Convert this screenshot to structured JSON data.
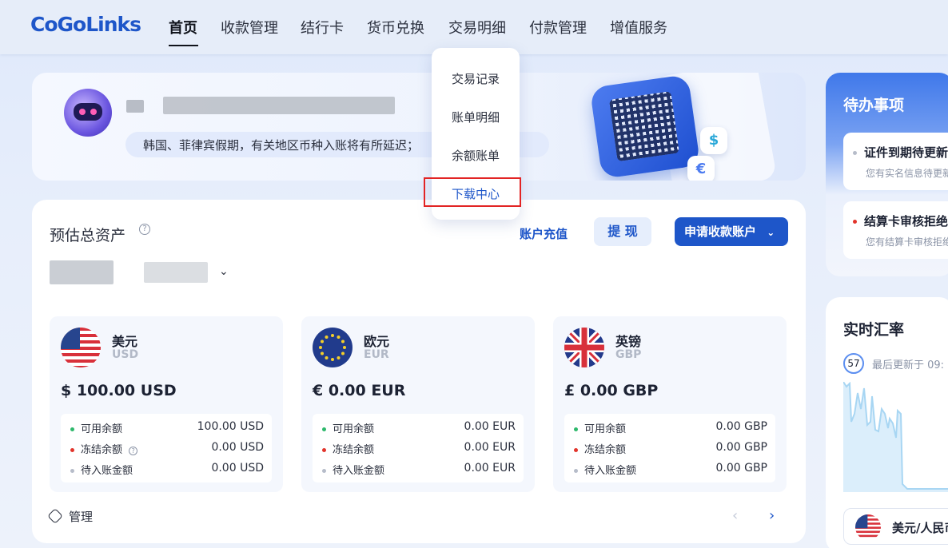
{
  "app": {
    "logo": "CoGoLinks"
  },
  "nav": {
    "items": [
      {
        "label": "首页",
        "active": true
      },
      {
        "label": "收款管理"
      },
      {
        "label": "结行卡"
      },
      {
        "label": "货币兑换"
      },
      {
        "label": "交易明细"
      },
      {
        "label": "付款管理"
      },
      {
        "label": "增值服务"
      }
    ]
  },
  "dropdown": {
    "items": [
      {
        "label": "交易记录"
      },
      {
        "label": "账单明细"
      },
      {
        "label": "余额账单"
      },
      {
        "label": "下载中心",
        "highlighted": true
      }
    ]
  },
  "banner": {
    "notice": "韩国、菲律宾假期，有关地区币种入账将有所延迟；"
  },
  "assets": {
    "title": "预估总资产",
    "help_icon": "question-circle-icon",
    "recharge_label": "账户充值",
    "withdraw_label": "提 现",
    "apply_label": "申请收款账户",
    "manage_label": "管理"
  },
  "currencies": [
    {
      "name": "美元",
      "code": "USD",
      "amount": "$ 100.00 USD",
      "flag": "us-flag-icon",
      "rows": [
        {
          "label": "可用余额",
          "value": "100.00 USD",
          "dot": "#2db86b"
        },
        {
          "label": "冻结余额",
          "value": "0.00 USD",
          "dot": "#e2342b",
          "help": true
        },
        {
          "label": "待入账金额",
          "value": "0.00 USD",
          "dot": "#b6bcc9"
        }
      ]
    },
    {
      "name": "欧元",
      "code": "EUR",
      "amount": "€ 0.00 EUR",
      "flag": "eu-flag-icon",
      "rows": [
        {
          "label": "可用余额",
          "value": "0.00 EUR",
          "dot": "#2db86b"
        },
        {
          "label": "冻结余额",
          "value": "0.00 EUR",
          "dot": "#e2342b"
        },
        {
          "label": "待入账金额",
          "value": "0.00 EUR",
          "dot": "#b6bcc9"
        }
      ]
    },
    {
      "name": "英镑",
      "code": "GBP",
      "amount": "£ 0.00 GBP",
      "flag": "uk-flag-icon",
      "rows": [
        {
          "label": "可用余额",
          "value": "0.00 GBP",
          "dot": "#2db86b"
        },
        {
          "label": "冻结余额",
          "value": "0.00 GBP",
          "dot": "#e2342b"
        },
        {
          "label": "待入账金额",
          "value": "0.00 GBP",
          "dot": "#b6bcc9"
        }
      ]
    }
  ],
  "todo": {
    "title": "待办事项",
    "items": [
      {
        "title": "证件到期待更新",
        "desc": "您有实名信息待更新",
        "dot": "#b6bcc9"
      },
      {
        "title": "结算卡审核拒绝",
        "desc": "您有结算卡审核拒绝",
        "dot": "#e2342b"
      }
    ]
  },
  "rates": {
    "title": "实时汇率",
    "countdown": "57",
    "updated": "最后更新于 09:",
    "pair_label": "美元/人民币",
    "pair_flag": "us-flag-icon"
  },
  "colors": {
    "accent": "#1e56c9",
    "highlight_border": "#e22424"
  }
}
